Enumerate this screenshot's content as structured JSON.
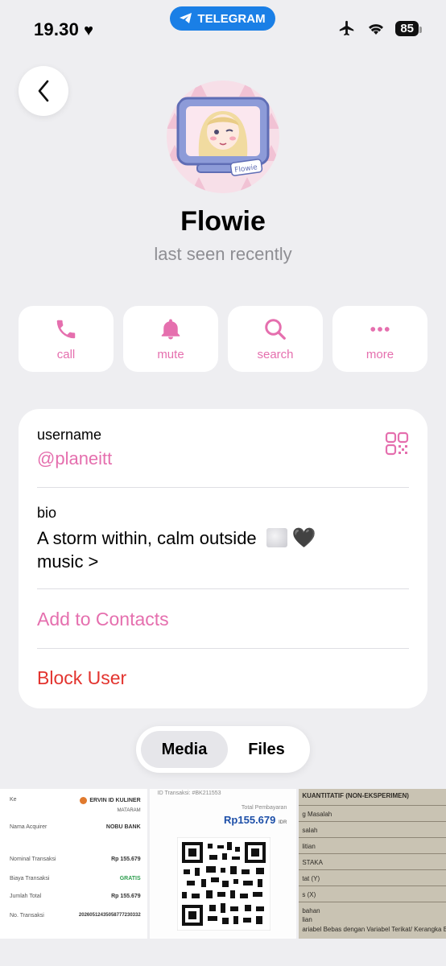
{
  "status": {
    "time": "19.30",
    "app_pill": "TELEGRAM",
    "battery": "85"
  },
  "profile": {
    "name": "Flowie",
    "status": "last seen recently"
  },
  "actions": [
    {
      "label": "call",
      "icon": "phone-icon"
    },
    {
      "label": "mute",
      "icon": "bell-icon"
    },
    {
      "label": "search",
      "icon": "search-icon"
    },
    {
      "label": "more",
      "icon": "more-icon"
    }
  ],
  "info": {
    "username_label": "username",
    "username": "@planeitt",
    "bio_label": "bio",
    "bio_line1": "A storm within, calm outside",
    "bio_line2": "music >",
    "add_contact": "Add to Contacts",
    "block_user": "Block User"
  },
  "tabs": {
    "media": "Media",
    "files": "Files",
    "active": "Media"
  },
  "media": {
    "receipt": {
      "merchant": "ERVIN ID KULINER",
      "city": "MATARAM",
      "rows": [
        {
          "k": "Ke",
          "v": ""
        },
        {
          "k": "Nama Acquirer",
          "v": "NOBU BANK"
        },
        {
          "k": "Nominal Transaksi",
          "v": "Rp 155.679"
        },
        {
          "k": "Biaya Transaksi",
          "v": "GRATIS"
        },
        {
          "k": "Jumlah Total",
          "v": "Rp 155.679"
        },
        {
          "k": "No. Transaksi",
          "v": "20260512435058777230332"
        }
      ]
    },
    "qris": {
      "id": "ID Transaksi: #BK211553",
      "total_label": "Total Pembayaran",
      "amount": "Rp155.679",
      "currency": "IDR"
    },
    "doc": {
      "heading": "KUANTITATIF (NON-EKSPERIMEN)",
      "lines": [
        "g Masalah",
        "salah",
        "litian",
        "STAKA",
        "tat (Y)",
        "s (X)",
        "bahan",
        "lian",
        "ariabel Bebas dengan Variabel Terikat/ Kerangka Be"
      ]
    }
  },
  "colors": {
    "accent": "#e56fae",
    "danger": "#e3342f",
    "telegram": "#1a7fe6"
  }
}
